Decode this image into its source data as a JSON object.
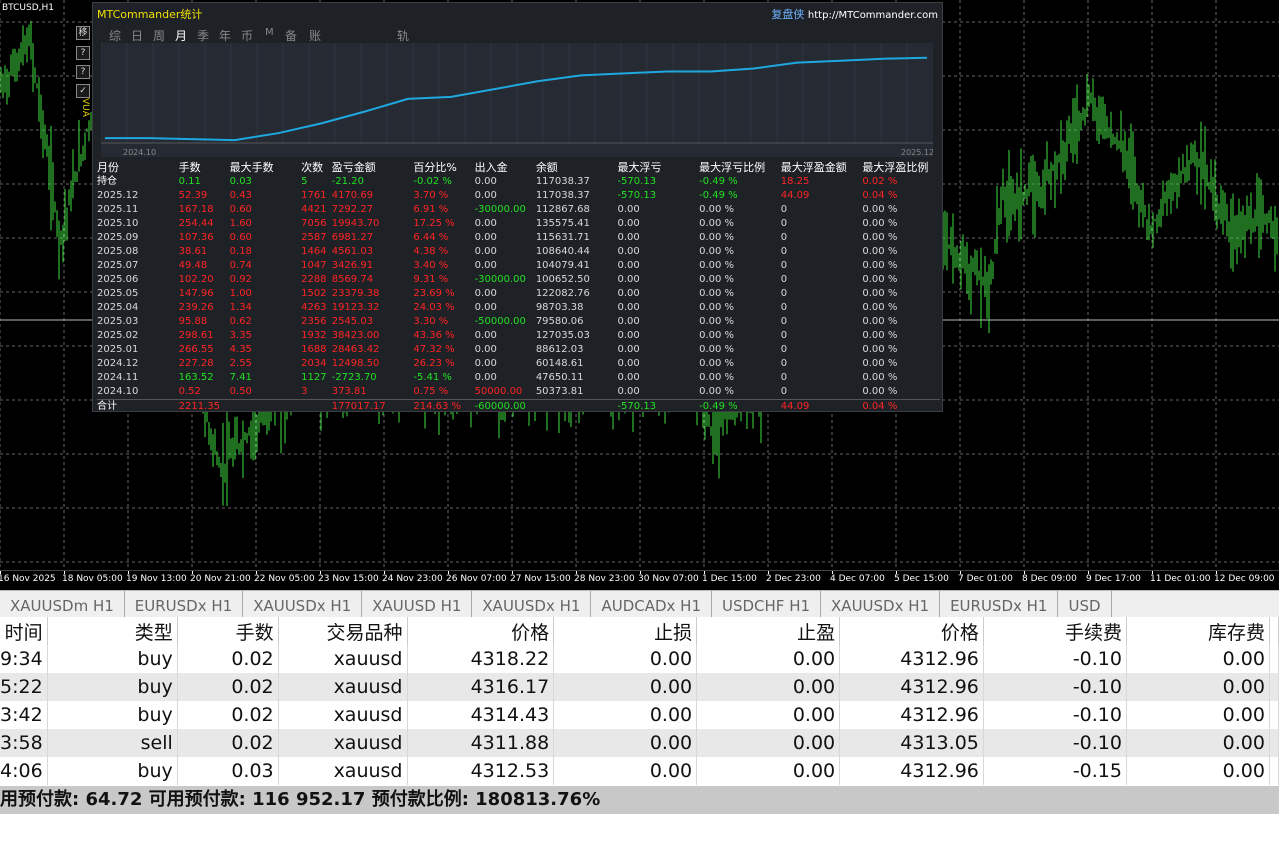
{
  "chart": {
    "symbol": "BTCUSD,H1",
    "tools": [
      "移",
      "?",
      "?",
      "✓"
    ],
    "xaxis_labels": [
      "16 Nov 2025",
      "18 Nov 05:00",
      "19 Nov 13:00",
      "20 Nov 21:00",
      "22 Nov 05:00",
      "23 Nov 15:00",
      "24 Nov 23:00",
      "26 Nov 07:00",
      "27 Nov 15:00",
      "28 Nov 23:00",
      "30 Nov 07:00",
      "1 Dec 15:00",
      "2 Dec 23:00",
      "4 Dec 07:00",
      "5 Dec 15:00",
      "7 Dec 01:00",
      "8 Dec 09:00",
      "9 Dec 17:00",
      "11 Dec 01:00",
      "12 Dec 09:00"
    ],
    "side_label": "VUA"
  },
  "panel": {
    "title": "MTCommander统计",
    "brand": "复盘侠",
    "url": "http://MTCommander.com",
    "tabs": [
      "综",
      "日",
      "周",
      "月",
      "季",
      "年",
      "币",
      "M",
      "备",
      "账户",
      "轨迹"
    ],
    "active_tab": "月",
    "equity_start": "2024.10",
    "equity_end": "2025.12",
    "equity_curve": [
      0.05,
      0.05,
      0.04,
      0.03,
      0.1,
      0.2,
      0.32,
      0.45,
      0.47,
      0.55,
      0.63,
      0.69,
      0.71,
      0.73,
      0.73,
      0.76,
      0.82,
      0.84,
      0.86,
      0.87
    ],
    "headers": [
      "月份",
      "手数",
      "最大手数",
      "次数",
      "盈亏金额",
      "百分比%",
      "出入金",
      "余额",
      "最大浮亏",
      "最大浮亏比例",
      "最大浮盈金额",
      "最大浮盈比例"
    ],
    "rows": [
      {
        "c": [
          "持仓",
          "0.11",
          "0.03",
          "5",
          "-21.20",
          "-0.02 %",
          "0.00",
          "117038.37",
          "-570.13",
          "-0.49 %",
          "18.25",
          "0.02 %"
        ],
        "t": [
          "wh",
          "gr",
          "gr",
          "gr",
          "gr",
          "gr",
          "gy",
          "gy",
          "gr",
          "gr",
          "re",
          "re"
        ]
      },
      {
        "c": [
          "2025.12",
          "52.39",
          "0.43",
          "1761",
          "4170.69",
          "3.70 %",
          "0.00",
          "117038.37",
          "-570.13",
          "-0.49 %",
          "44.09",
          "0.04 %"
        ],
        "t": [
          "gy",
          "re",
          "re",
          "re",
          "re",
          "re",
          "gy",
          "gy",
          "gr",
          "gr",
          "re",
          "re"
        ]
      },
      {
        "c": [
          "2025.11",
          "167.18",
          "0.60",
          "4421",
          "7292.27",
          "6.91 %",
          "-30000.00",
          "112867.68",
          "0.00",
          "0.00 %",
          "0",
          "0.00 %"
        ],
        "t": [
          "gy",
          "re",
          "re",
          "re",
          "re",
          "re",
          "gr",
          "gy",
          "gy",
          "gy",
          "gy",
          "gy"
        ]
      },
      {
        "c": [
          "2025.10",
          "254.44",
          "1.60",
          "7056",
          "19943.70",
          "17.25 %",
          "0.00",
          "135575.41",
          "0.00",
          "0.00 %",
          "0",
          "0.00 %"
        ],
        "t": [
          "gy",
          "re",
          "re",
          "re",
          "re",
          "re",
          "gy",
          "gy",
          "gy",
          "gy",
          "gy",
          "gy"
        ]
      },
      {
        "c": [
          "2025.09",
          "107.36",
          "0.60",
          "2587",
          "6981.27",
          "6.44 %",
          "0.00",
          "115631.71",
          "0.00",
          "0.00 %",
          "0",
          "0.00 %"
        ],
        "t": [
          "gy",
          "re",
          "re",
          "re",
          "re",
          "re",
          "gy",
          "gy",
          "gy",
          "gy",
          "gy",
          "gy"
        ]
      },
      {
        "c": [
          "2025.08",
          "38.61",
          "0.18",
          "1464",
          "4561.03",
          "4.38 %",
          "0.00",
          "108640.44",
          "0.00",
          "0.00 %",
          "0",
          "0.00 %"
        ],
        "t": [
          "gy",
          "re",
          "re",
          "re",
          "re",
          "re",
          "gy",
          "gy",
          "gy",
          "gy",
          "gy",
          "gy"
        ]
      },
      {
        "c": [
          "2025.07",
          "49.48",
          "0.74",
          "1047",
          "3426.91",
          "3.40 %",
          "0.00",
          "104079.41",
          "0.00",
          "0.00 %",
          "0",
          "0.00 %"
        ],
        "t": [
          "gy",
          "re",
          "re",
          "re",
          "re",
          "re",
          "gy",
          "gy",
          "gy",
          "gy",
          "gy",
          "gy"
        ]
      },
      {
        "c": [
          "2025.06",
          "102.20",
          "0.92",
          "2288",
          "8569.74",
          "9.31 %",
          "-30000.00",
          "100652.50",
          "0.00",
          "0.00 %",
          "0",
          "0.00 %"
        ],
        "t": [
          "gy",
          "re",
          "re",
          "re",
          "re",
          "re",
          "gr",
          "gy",
          "gy",
          "gy",
          "gy",
          "gy"
        ]
      },
      {
        "c": [
          "2025.05",
          "147.96",
          "1.00",
          "1502",
          "23379.38",
          "23.69 %",
          "0.00",
          "122082.76",
          "0.00",
          "0.00 %",
          "0",
          "0.00 %"
        ],
        "t": [
          "gy",
          "re",
          "re",
          "re",
          "re",
          "re",
          "gy",
          "gy",
          "gy",
          "gy",
          "gy",
          "gy"
        ]
      },
      {
        "c": [
          "2025.04",
          "239.26",
          "1.34",
          "4263",
          "19123.32",
          "24.03 %",
          "0.00",
          "98703.38",
          "0.00",
          "0.00 %",
          "0",
          "0.00 %"
        ],
        "t": [
          "gy",
          "re",
          "re",
          "re",
          "re",
          "re",
          "gy",
          "gy",
          "gy",
          "gy",
          "gy",
          "gy"
        ]
      },
      {
        "c": [
          "2025.03",
          "95.88",
          "0.62",
          "2356",
          "2545.03",
          "3.30 %",
          "-50000.00",
          "79580.06",
          "0.00",
          "0.00 %",
          "0",
          "0.00 %"
        ],
        "t": [
          "gy",
          "re",
          "re",
          "re",
          "re",
          "re",
          "gr",
          "gy",
          "gy",
          "gy",
          "gy",
          "gy"
        ]
      },
      {
        "c": [
          "2025.02",
          "298.61",
          "3.35",
          "1932",
          "38423.00",
          "43.36 %",
          "0.00",
          "127035.03",
          "0.00",
          "0.00 %",
          "0",
          "0.00 %"
        ],
        "t": [
          "gy",
          "re",
          "re",
          "re",
          "re",
          "re",
          "gy",
          "gy",
          "gy",
          "gy",
          "gy",
          "gy"
        ]
      },
      {
        "c": [
          "2025.01",
          "266.55",
          "4.35",
          "1688",
          "28463.42",
          "47.32 %",
          "0.00",
          "88612.03",
          "0.00",
          "0.00 %",
          "0",
          "0.00 %"
        ],
        "t": [
          "gy",
          "re",
          "re",
          "re",
          "re",
          "re",
          "gy",
          "gy",
          "gy",
          "gy",
          "gy",
          "gy"
        ]
      },
      {
        "c": [
          "2024.12",
          "227.28",
          "2.55",
          "2034",
          "12498.50",
          "26.23 %",
          "0.00",
          "60148.61",
          "0.00",
          "0.00 %",
          "0",
          "0.00 %"
        ],
        "t": [
          "gy",
          "re",
          "re",
          "re",
          "re",
          "re",
          "gy",
          "gy",
          "gy",
          "gy",
          "gy",
          "gy"
        ]
      },
      {
        "c": [
          "2024.11",
          "163.52",
          "7.41",
          "1127",
          "-2723.70",
          "-5.41 %",
          "0.00",
          "47650.11",
          "0.00",
          "0.00 %",
          "0",
          "0.00 %"
        ],
        "t": [
          "gy",
          "gr",
          "gr",
          "gr",
          "gr",
          "gr",
          "gy",
          "gy",
          "gy",
          "gy",
          "gy",
          "gy"
        ]
      },
      {
        "c": [
          "2024.10",
          "0.52",
          "0.50",
          "3",
          "373.81",
          "0.75 %",
          "50000.00",
          "50373.81",
          "0.00",
          "0.00 %",
          "0",
          "0.00 %"
        ],
        "t": [
          "gy",
          "re",
          "re",
          "re",
          "re",
          "re",
          "re",
          "gy",
          "gy",
          "gy",
          "gy",
          "gy"
        ]
      }
    ],
    "total": {
      "c": [
        "合计",
        "2211.35",
        "",
        "",
        "177017.17",
        "214.63 %",
        "-60000.00",
        "",
        "-570.13",
        "-0.49 %",
        "44.09",
        "0.04 %"
      ],
      "t": [
        "wh",
        "re",
        "re",
        "re",
        "re",
        "re",
        "gr",
        "gy",
        "gr",
        "gr",
        "re",
        "re"
      ]
    }
  },
  "chart_tabs": [
    "XAUUSDm H1",
    "EURUSDx H1",
    "XAUUSDx H1",
    "XAUUSD H1",
    "XAUUSDx H1",
    "AUDCADx H1",
    "USDCHF H1",
    "XAUUSDx H1",
    "EURUSDx H1",
    "USD"
  ],
  "orders": {
    "headers": [
      "时间",
      "类型",
      "手数",
      "交易品种",
      "价格",
      "止损",
      "止盈",
      "价格",
      "手续费",
      "库存费"
    ],
    "rows": [
      [
        "9:34",
        "buy",
        "0.02",
        "xauusd",
        "4318.22",
        "0.00",
        "0.00",
        "4312.96",
        "-0.10",
        "0.00"
      ],
      [
        "5:22",
        "buy",
        "0.02",
        "xauusd",
        "4316.17",
        "0.00",
        "0.00",
        "4312.96",
        "-0.10",
        "0.00"
      ],
      [
        "3:42",
        "buy",
        "0.02",
        "xauusd",
        "4314.43",
        "0.00",
        "0.00",
        "4312.96",
        "-0.10",
        "0.00"
      ],
      [
        "3:58",
        "sell",
        "0.02",
        "xauusd",
        "4311.88",
        "0.00",
        "0.00",
        "4313.05",
        "-0.10",
        "0.00"
      ],
      [
        "4:06",
        "buy",
        "0.03",
        "xauusd",
        "4312.53",
        "0.00",
        "0.00",
        "4312.96",
        "-0.15",
        "0.00"
      ]
    ]
  },
  "status": "用预付款: 64.72   可用预付款: 116 952.17   预付款比例: 180813.76%",
  "colors": {
    "green": "#22e122",
    "red": "#ff2424",
    "line": "#1fa8e0",
    "candle": "#3fdc3f"
  }
}
